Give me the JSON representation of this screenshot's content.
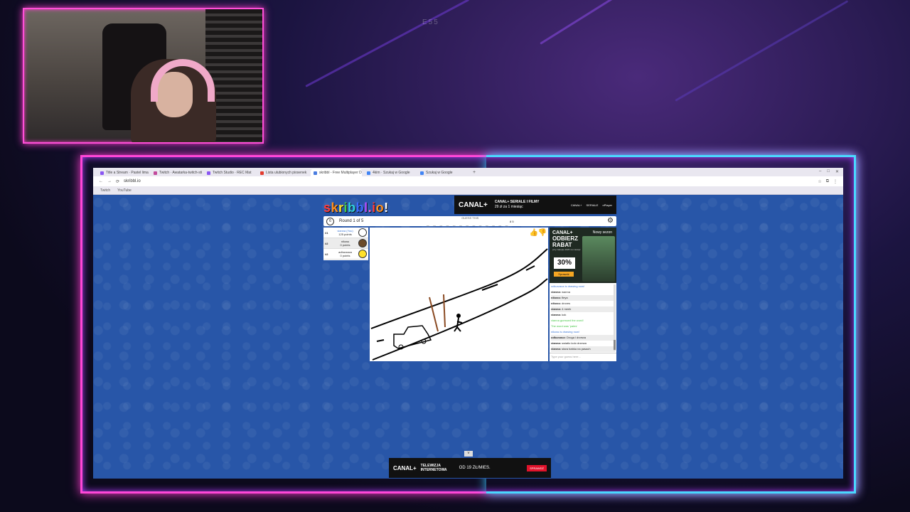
{
  "stream": {
    "label": "E55"
  },
  "browser": {
    "tabs": [
      {
        "label": "Title a Stream · Pastel lima al",
        "color": "#8a56f2"
      },
      {
        "label": "Twitch · Awatarka-twitch-sti-6",
        "color": "#c24a9c"
      },
      {
        "label": "Twitch Studio · REC Mat",
        "color": "#8a56f2"
      },
      {
        "label": "Lista ulubionych piosenek",
        "color": "#e23b2e"
      },
      {
        "label": "skribbl - Free Multiplayer D",
        "color": "#4a7de0"
      },
      {
        "label": "4kim · Szukaj w Google",
        "color": "#4285f4"
      },
      {
        "label": "Szukaj w Google",
        "color": "#4285f4"
      }
    ],
    "new_tab": "+",
    "url": "skribbl.io",
    "bookmarks": [
      "Twitch",
      "YouTube"
    ]
  },
  "game": {
    "logo": "skribbl.io",
    "round": "Round 1 of 5",
    "timer": "6",
    "guess_this": "GUESS THIS",
    "word_pattern": "_ _ _ _ _ _ _ _  _ _ _ _ _",
    "word_count": "8 5",
    "settings_icon": "gear-icon",
    "players": [
      {
        "rank": "#1",
        "name": "vianna (You)",
        "points": "125 points",
        "is_me": true
      },
      {
        "rank": "#2",
        "name": "nikoss",
        "points": "0 points",
        "is_me": false
      },
      {
        "rank": "#2",
        "name": "adhurzaca",
        "points": "0 points",
        "is_me": false
      }
    ],
    "chat": [
      {
        "text": "odkurzaca is drawing now!",
        "style": "blue"
      },
      {
        "user": "vianna:",
        "text": " wanna",
        "style": ""
      },
      {
        "user": "nikoss:",
        "text": " fleya",
        "style": "alt"
      },
      {
        "user": "nikoss:",
        "text": " droves",
        "style": ""
      },
      {
        "user": "vianna:",
        "text": " 4 meek",
        "style": "alt"
      },
      {
        "user": "vianna:",
        "text": " kok",
        "style": ""
      },
      {
        "text": "vianna guessed the word!",
        "style": "green"
      },
      {
        "text": "The word was 'pales'",
        "style": "green"
      },
      {
        "text": "nikoss is drawing now!",
        "style": "blue"
      },
      {
        "user": "odkurzacz:",
        "text": " Droga i drzewa",
        "style": "alt"
      },
      {
        "user": "vianna:",
        "text": " swiatlo kolo drzewa",
        "style": ""
      },
      {
        "user": "vianna:",
        "text": " stara babka na pasach",
        "style": "alt"
      },
      {
        "user": "vianna:",
        "text": " tupa samoto",
        "style": ""
      }
    ],
    "chat_placeholder": "Type your guess here..."
  },
  "ads": {
    "top": {
      "brand": "CANAL+",
      "title": "CANAL+ SERIALE I FILMY",
      "subtitle": "29 zł za 1 miesiąc"
    },
    "side": {
      "brand": "CANAL+",
      "headline": "ODBIERZ RABAT",
      "sub": "przy zakupie 2025 na miesiąc",
      "percent": "30%",
      "button": "Sprawdź",
      "tag": "Nowy sezon"
    },
    "bottom": {
      "brand": "CANAL+",
      "title": "TELEWIZJA INTERNETOWA",
      "price": "OD 19 ZŁ/MIES.",
      "cta": "SPRAWDŹ"
    },
    "close": "˅"
  }
}
